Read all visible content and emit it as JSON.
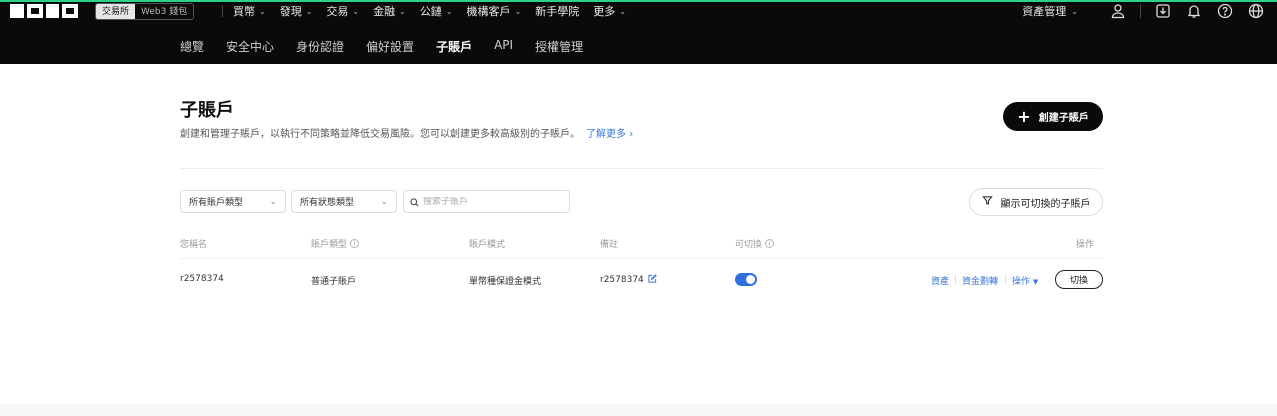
{
  "topbar": {
    "modes": [
      "交易所",
      "Web3 錢包"
    ],
    "nav": [
      "買幣",
      "發現",
      "交易",
      "金融",
      "公鏈",
      "機構客戶",
      "新手學院",
      "更多"
    ],
    "asset_label": "資產管理",
    "subnav": [
      "總覽",
      "安全中心",
      "身份認證",
      "偏好設置",
      "子賬戶",
      "API",
      "授權管理"
    ],
    "active_subnav": "子賬戶"
  },
  "header": {
    "title": "子賬戶",
    "description": "創建和管理子賬戶，以執行不同策略並降低交易風險。您可以創建更多較高級別的子賬戶。",
    "learn_more": "了解更多",
    "create_button": "創建子賬戶"
  },
  "filters": {
    "account_type": "所有賬戶類型",
    "status_type": "所有狀態類型",
    "search_placeholder": "搜索子賬戶",
    "switchable_button": "顯示可切換的子賬戶"
  },
  "table": {
    "headers": [
      "您稱名",
      "賬戶類型",
      "賬戶模式",
      "備註",
      "可切換",
      "操作"
    ],
    "rows": [
      {
        "name": "r2578374",
        "type": "普通子賬戶",
        "mode": "單幣種保證金模式",
        "note": "r2578374",
        "switchable": true,
        "actions": [
          "資產",
          "資金劃轉",
          "操作"
        ],
        "switch_button": "切換"
      }
    ]
  },
  "colors": {
    "accent_green": "#2fd08a",
    "link_blue": "#3a78d8",
    "toggle_blue": "#2f6fe0"
  }
}
